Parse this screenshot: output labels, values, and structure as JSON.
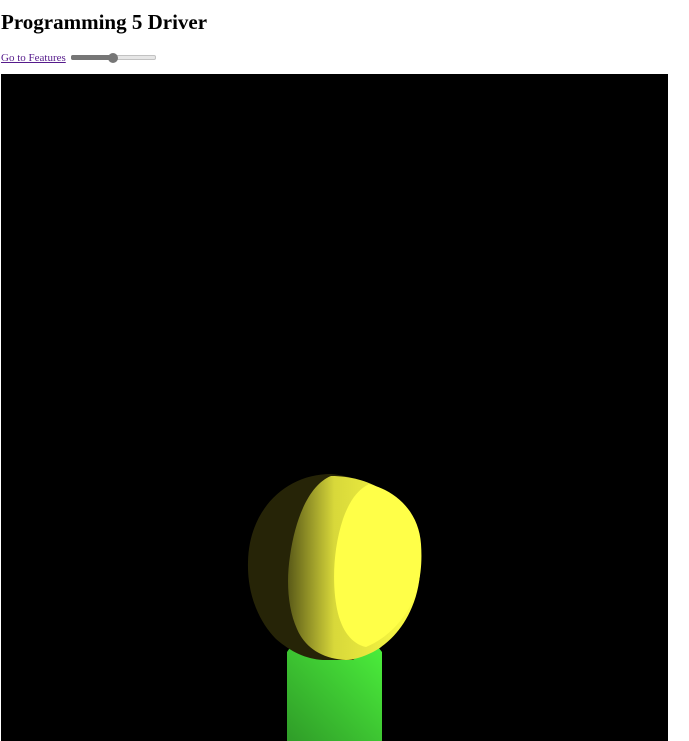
{
  "page": {
    "title": "Programming 5 Driver"
  },
  "controls": {
    "features_link": "Go to Features",
    "slider_value": 0.5
  },
  "scene": {
    "background": "#000000",
    "head_color": "#ffff44",
    "body_color": "#44e044"
  }
}
